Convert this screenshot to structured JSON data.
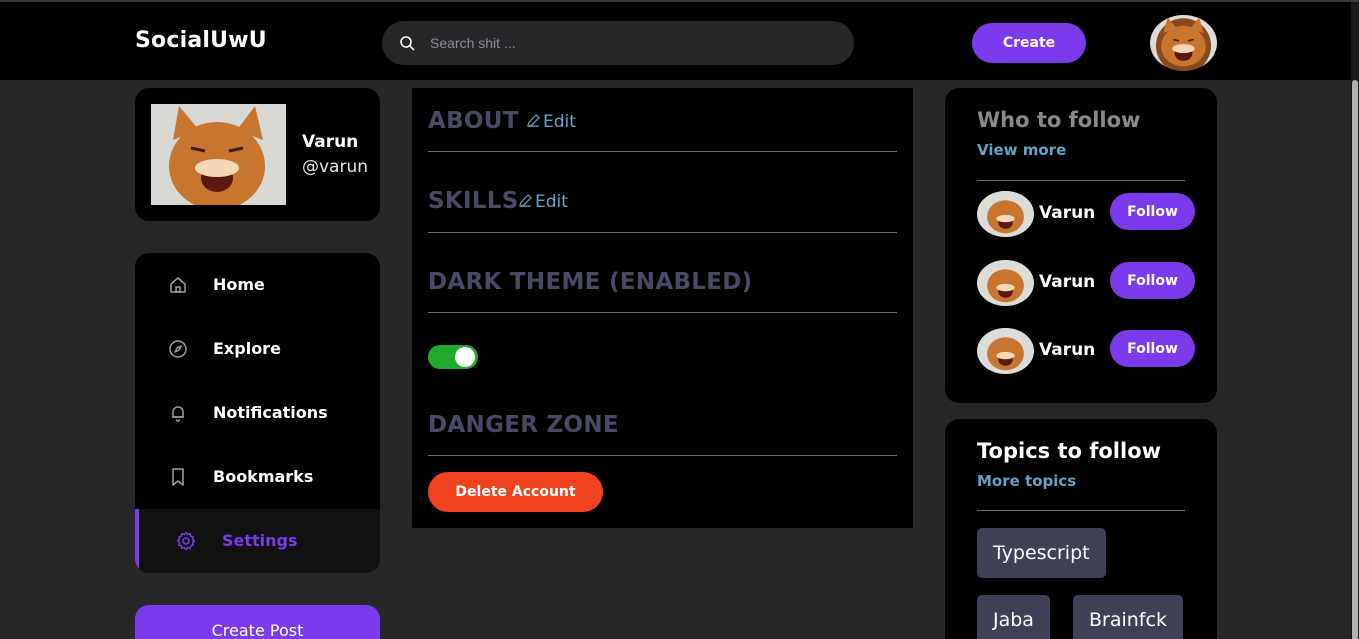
{
  "header": {
    "brand": "SocialUwU",
    "search_placeholder": "Search shit ...",
    "search_icon": "search-icon",
    "create_label": "Create",
    "avatar_icon": "cat-avatar"
  },
  "profile": {
    "name": "Varun",
    "handle": "@varun"
  },
  "nav": {
    "items": [
      {
        "label": "Home",
        "icon": "home-icon"
      },
      {
        "label": "Explore",
        "icon": "compass-icon"
      },
      {
        "label": "Notifications",
        "icon": "bell-icon"
      },
      {
        "label": "Bookmarks",
        "icon": "bookmark-icon"
      },
      {
        "label": "Settings",
        "icon": "gear-icon",
        "active": true
      }
    ],
    "create_post_label": "Create Post"
  },
  "settings": {
    "about_title": "ABOUT",
    "skills_title": "SKILLS",
    "edit_label": "Edit",
    "theme_title": "DARK THEME (ENABLED)",
    "theme_enabled": true,
    "danger_title": "DANGER ZONE",
    "delete_label": "Delete Account"
  },
  "who_to_follow": {
    "title": "Who to follow",
    "view_more": "View more",
    "users": [
      {
        "name": "Varun",
        "button": "Follow"
      },
      {
        "name": "Varun",
        "button": "Follow"
      },
      {
        "name": "Varun",
        "button": "Follow"
      }
    ]
  },
  "topics": {
    "title": "Topics to follow",
    "more": "More topics",
    "chips": [
      "Typescript",
      "Jaba",
      "Brainfck"
    ]
  },
  "colors": {
    "accent": "#7c3aed",
    "danger": "#f04420",
    "toggle_on": "#22aa2e",
    "link": "#60a5c8",
    "section_title": "#4a4a66"
  }
}
